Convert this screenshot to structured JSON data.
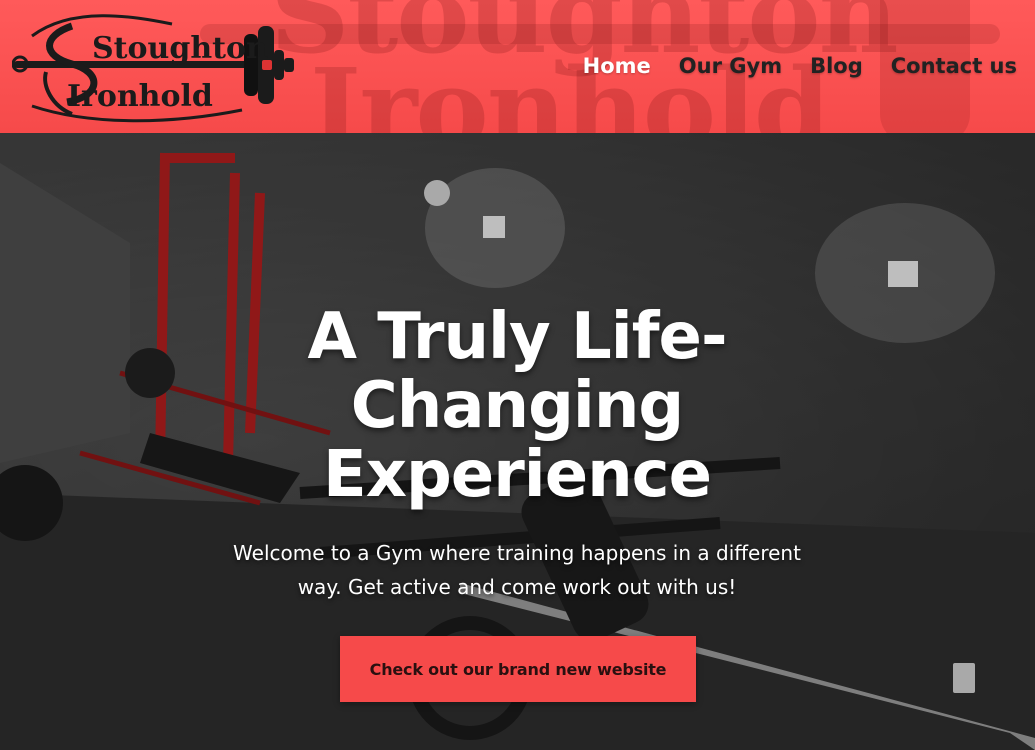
{
  "brand": {
    "logo_line1": "Stoughton",
    "logo_line2": "Ironhold",
    "watermark_line1": "Stoughton",
    "watermark_line2": "Ironhold"
  },
  "nav": {
    "items": [
      {
        "label": "Home",
        "active": true
      },
      {
        "label": "Our Gym",
        "active": false
      },
      {
        "label": "Blog",
        "active": false
      },
      {
        "label": "Contact us",
        "active": false
      }
    ]
  },
  "hero": {
    "title": "A Truly Life-Changing Experience",
    "subtitle": "Welcome to a Gym where training happens in a different way. Get active and come work out with us!",
    "button_label": "Check out our brand new website"
  },
  "colors": {
    "header_red": "#f64a4a",
    "button_red": "#f64a4a",
    "nav_active": "#ffffff",
    "nav_text": "#222222"
  },
  "icons": [
    "barbell-logo-icon"
  ]
}
